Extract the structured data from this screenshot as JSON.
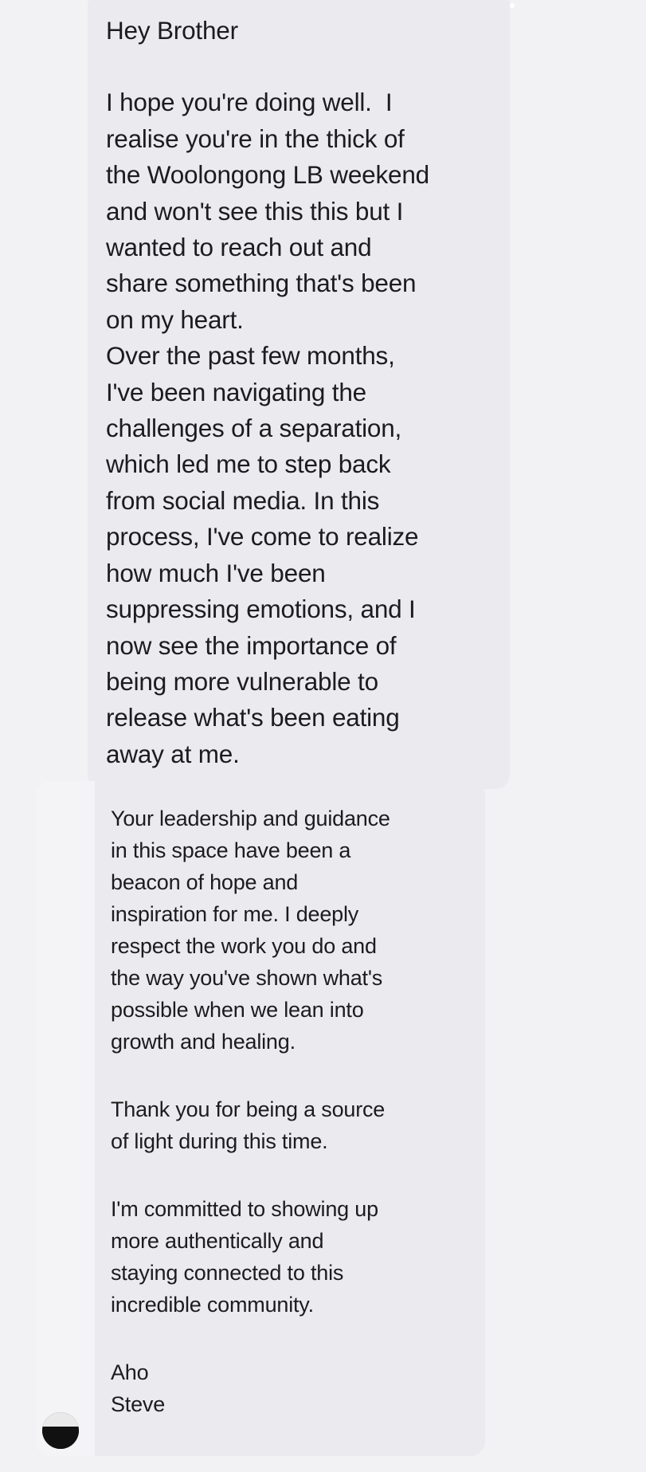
{
  "message_1": {
    "greeting": "Hey Brother",
    "body": "I hope you're doing well.  I\nrealise you're in the thick of\nthe Woolongong LB weekend\nand won't see this this but I\nwanted to reach out and\nshare something that's been\non my heart.\nOver the past few months,\nI've been navigating the\nchallenges of a separation,\nwhich led me to step back\nfrom social media. In this\nprocess, I've come to realize\nhow much I've been\nsuppressing emotions, and I\nnow see the importance of\nbeing more vulnerable to\nrelease what's been eating\naway at me."
  },
  "message_2": {
    "paragraph_1": "Your leadership and guidance\nin this space have been a\nbeacon of hope and\ninspiration for me. I deeply\nrespect the work you do and\nthe way you've shown what's\npossible when we lean into\ngrowth and healing.",
    "paragraph_2": "Thank you for being a source\nof light during this time.",
    "paragraph_3": "I'm committed to showing up\nmore authentically and\nstaying connected to this\nincredible community.",
    "signoff": "Aho\nSteve"
  },
  "sender": {
    "avatar_icon": "profile-avatar-icon"
  }
}
